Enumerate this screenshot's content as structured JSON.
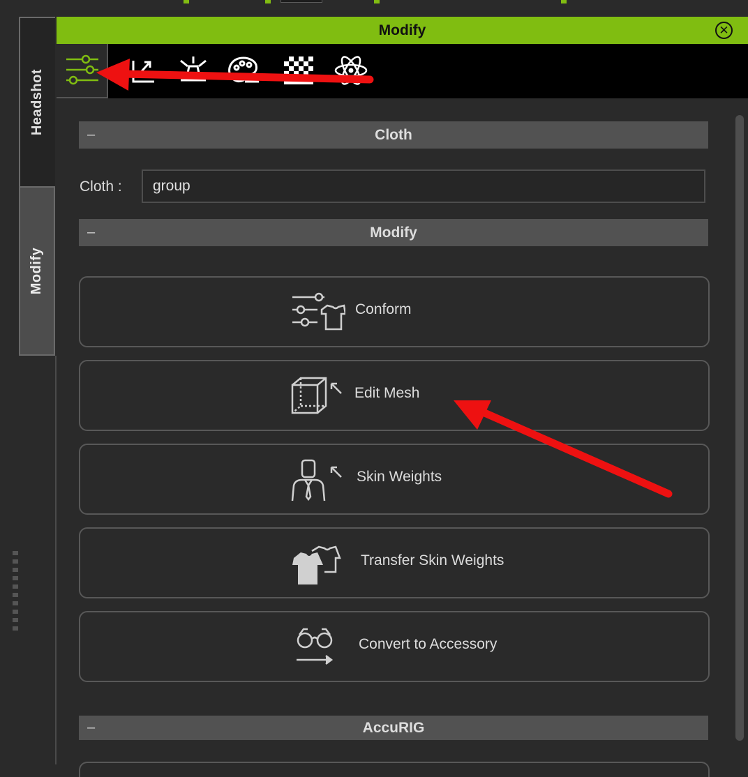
{
  "left_tabs": {
    "headshot": "Headshot",
    "modify": "Modify"
  },
  "panel": {
    "title": "Modify",
    "close_icon": "close-circle-icon"
  },
  "toolbar": {
    "tools": [
      "sliders-icon",
      "morph-icon",
      "transform-icon",
      "palette-icon",
      "checker-texture-icon",
      "atom-physics-icon"
    ]
  },
  "sections": {
    "cloth": {
      "header": "Cloth",
      "field_label": "Cloth :",
      "field_value": "group"
    },
    "modify": {
      "header": "Modify",
      "buttons": [
        {
          "label": "Conform",
          "icon": "conform-icon"
        },
        {
          "label": "Edit Mesh",
          "icon": "edit-mesh-icon"
        },
        {
          "label": "Skin Weights",
          "icon": "skin-weights-icon"
        },
        {
          "label": "Transfer Skin Weights",
          "icon": "transfer-skin-weights-icon"
        },
        {
          "label": "Convert to Accessory",
          "icon": "convert-accessory-icon"
        }
      ]
    },
    "accurig": {
      "header": "AccuRIG"
    }
  },
  "colors": {
    "accent": "#80bd11",
    "annotation": "#ee1111",
    "panel_bg": "#2a2a2a",
    "section_bg": "#525252"
  }
}
